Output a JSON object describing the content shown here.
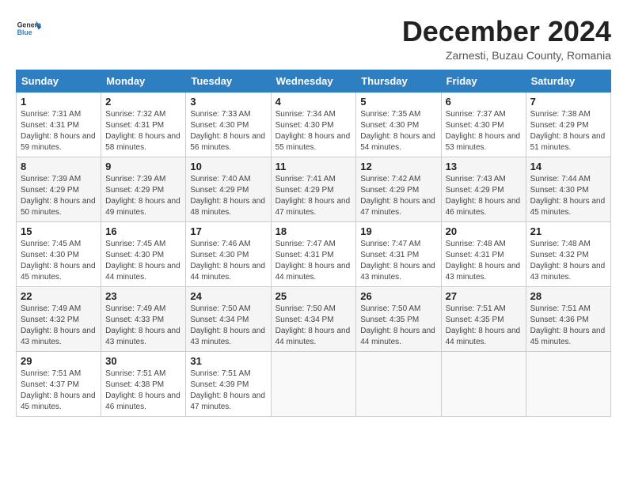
{
  "header": {
    "logo_general": "General",
    "logo_blue": "Blue",
    "month_title": "December 2024",
    "location": "Zarnesti, Buzau County, Romania"
  },
  "weekdays": [
    "Sunday",
    "Monday",
    "Tuesday",
    "Wednesday",
    "Thursday",
    "Friday",
    "Saturday"
  ],
  "weeks": [
    [
      {
        "day": "1",
        "sunrise": "7:31 AM",
        "sunset": "4:31 PM",
        "daylight": "8 hours and 59 minutes."
      },
      {
        "day": "2",
        "sunrise": "7:32 AM",
        "sunset": "4:31 PM",
        "daylight": "8 hours and 58 minutes."
      },
      {
        "day": "3",
        "sunrise": "7:33 AM",
        "sunset": "4:30 PM",
        "daylight": "8 hours and 56 minutes."
      },
      {
        "day": "4",
        "sunrise": "7:34 AM",
        "sunset": "4:30 PM",
        "daylight": "8 hours and 55 minutes."
      },
      {
        "day": "5",
        "sunrise": "7:35 AM",
        "sunset": "4:30 PM",
        "daylight": "8 hours and 54 minutes."
      },
      {
        "day": "6",
        "sunrise": "7:37 AM",
        "sunset": "4:30 PM",
        "daylight": "8 hours and 53 minutes."
      },
      {
        "day": "7",
        "sunrise": "7:38 AM",
        "sunset": "4:29 PM",
        "daylight": "8 hours and 51 minutes."
      }
    ],
    [
      {
        "day": "8",
        "sunrise": "7:39 AM",
        "sunset": "4:29 PM",
        "daylight": "8 hours and 50 minutes."
      },
      {
        "day": "9",
        "sunrise": "7:39 AM",
        "sunset": "4:29 PM",
        "daylight": "8 hours and 49 minutes."
      },
      {
        "day": "10",
        "sunrise": "7:40 AM",
        "sunset": "4:29 PM",
        "daylight": "8 hours and 48 minutes."
      },
      {
        "day": "11",
        "sunrise": "7:41 AM",
        "sunset": "4:29 PM",
        "daylight": "8 hours and 47 minutes."
      },
      {
        "day": "12",
        "sunrise": "7:42 AM",
        "sunset": "4:29 PM",
        "daylight": "8 hours and 47 minutes."
      },
      {
        "day": "13",
        "sunrise": "7:43 AM",
        "sunset": "4:29 PM",
        "daylight": "8 hours and 46 minutes."
      },
      {
        "day": "14",
        "sunrise": "7:44 AM",
        "sunset": "4:30 PM",
        "daylight": "8 hours and 45 minutes."
      }
    ],
    [
      {
        "day": "15",
        "sunrise": "7:45 AM",
        "sunset": "4:30 PM",
        "daylight": "8 hours and 45 minutes."
      },
      {
        "day": "16",
        "sunrise": "7:45 AM",
        "sunset": "4:30 PM",
        "daylight": "8 hours and 44 minutes."
      },
      {
        "day": "17",
        "sunrise": "7:46 AM",
        "sunset": "4:30 PM",
        "daylight": "8 hours and 44 minutes."
      },
      {
        "day": "18",
        "sunrise": "7:47 AM",
        "sunset": "4:31 PM",
        "daylight": "8 hours and 44 minutes."
      },
      {
        "day": "19",
        "sunrise": "7:47 AM",
        "sunset": "4:31 PM",
        "daylight": "8 hours and 43 minutes."
      },
      {
        "day": "20",
        "sunrise": "7:48 AM",
        "sunset": "4:31 PM",
        "daylight": "8 hours and 43 minutes."
      },
      {
        "day": "21",
        "sunrise": "7:48 AM",
        "sunset": "4:32 PM",
        "daylight": "8 hours and 43 minutes."
      }
    ],
    [
      {
        "day": "22",
        "sunrise": "7:49 AM",
        "sunset": "4:32 PM",
        "daylight": "8 hours and 43 minutes."
      },
      {
        "day": "23",
        "sunrise": "7:49 AM",
        "sunset": "4:33 PM",
        "daylight": "8 hours and 43 minutes."
      },
      {
        "day": "24",
        "sunrise": "7:50 AM",
        "sunset": "4:34 PM",
        "daylight": "8 hours and 43 minutes."
      },
      {
        "day": "25",
        "sunrise": "7:50 AM",
        "sunset": "4:34 PM",
        "daylight": "8 hours and 44 minutes."
      },
      {
        "day": "26",
        "sunrise": "7:50 AM",
        "sunset": "4:35 PM",
        "daylight": "8 hours and 44 minutes."
      },
      {
        "day": "27",
        "sunrise": "7:51 AM",
        "sunset": "4:35 PM",
        "daylight": "8 hours and 44 minutes."
      },
      {
        "day": "28",
        "sunrise": "7:51 AM",
        "sunset": "4:36 PM",
        "daylight": "8 hours and 45 minutes."
      }
    ],
    [
      {
        "day": "29",
        "sunrise": "7:51 AM",
        "sunset": "4:37 PM",
        "daylight": "8 hours and 45 minutes."
      },
      {
        "day": "30",
        "sunrise": "7:51 AM",
        "sunset": "4:38 PM",
        "daylight": "8 hours and 46 minutes."
      },
      {
        "day": "31",
        "sunrise": "7:51 AM",
        "sunset": "4:39 PM",
        "daylight": "8 hours and 47 minutes."
      },
      null,
      null,
      null,
      null
    ]
  ]
}
